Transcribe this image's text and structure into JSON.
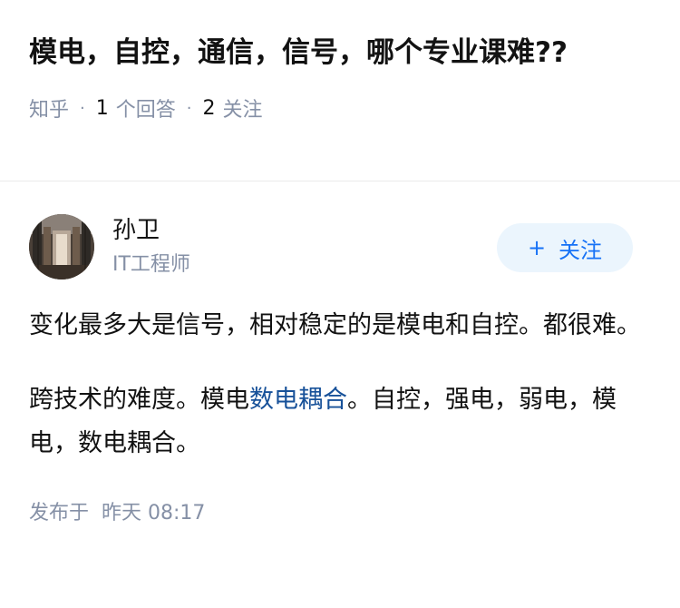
{
  "question": {
    "title": "模电，自控，通信，信号，哪个专业课难??",
    "source": "知乎",
    "answer_count": "1",
    "answer_label": "个回答",
    "follow_count": "2",
    "follow_label": "关注"
  },
  "answer": {
    "author": {
      "name": "孙卫",
      "title": "IT工程师",
      "avatar_icon": "avatar-photo"
    },
    "follow_button": {
      "plus": "+",
      "label": "关注"
    },
    "paragraph1": "变化最多大是信号，相对稳定的是模电和自控。都很难。",
    "paragraph2": {
      "before": "跨技术的难度。模电",
      "link": "数电耦合",
      "after": "。自控，强电，弱电，模电，数电耦合。"
    },
    "posted_label": "发布于",
    "posted_time": "昨天 08:17"
  },
  "colors": {
    "link": "#175199",
    "accent": "#1772f6",
    "meta": "#8590a6",
    "button_bg": "#ebf5fd"
  }
}
